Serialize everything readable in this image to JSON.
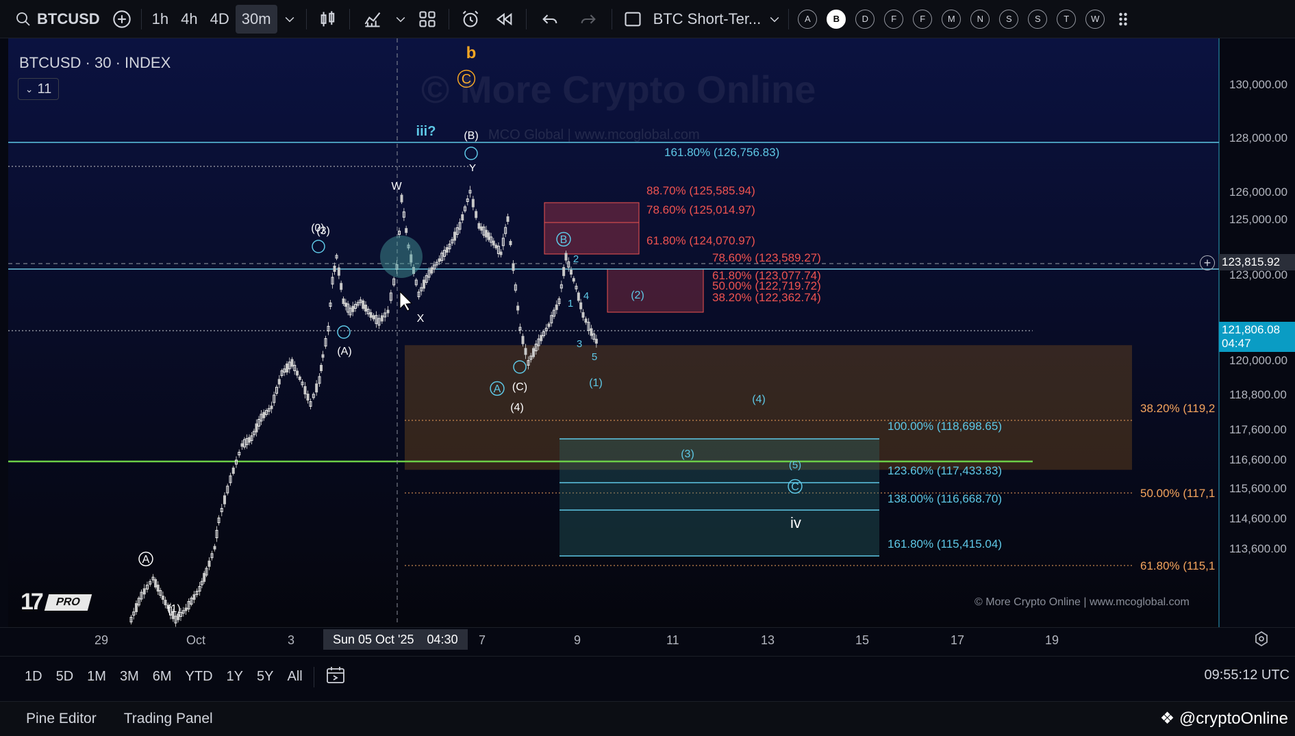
{
  "toolbar": {
    "symbol": "BTCUSD",
    "intervals": [
      "1h",
      "4h",
      "4D",
      "30m"
    ],
    "active_interval": "30m",
    "layout_name": "BTC Short-Ter...",
    "alert_letters": [
      "A",
      "B",
      "D",
      "F",
      "F",
      "M",
      "N",
      "S",
      "S",
      "T",
      "W"
    ],
    "active_letter_index": 1
  },
  "legend": {
    "title": "BTCUSD · 30 · INDEX",
    "indicator_count": "11"
  },
  "watermark": {
    "big": "© More Crypto Online",
    "sub": "MCO Global  |  www.mcoglobal.com",
    "footer": "© More Crypto Online  |  www.mcoglobal.com"
  },
  "price_scale": {
    "labels": [
      "130,000.00",
      "128,000.00",
      "126,000.00",
      "125,000.00",
      "123,000.00",
      "120,000.00",
      "118,800.00",
      "117,600.00",
      "116,600.00",
      "115,600.00",
      "114,600.00",
      "113,600.00"
    ],
    "crosshair_price": "123,815.92",
    "last_price": "121,806.08",
    "countdown": "04:47"
  },
  "colors": {
    "background": "#060812",
    "up": "#e8e8e8",
    "fib_cyan": "#5ec8e6",
    "fib_red": "#ef5350",
    "fib_orange": "#f5a45d",
    "support_green": "#6ccf48",
    "wave_orange": "#f5a623"
  },
  "chart_data": {
    "type": "candlestick",
    "timeframe": "30",
    "x_ticks": [
      "29",
      "Oct",
      "3",
      "Sun 05 Oct '25",
      "04:30",
      "7",
      "9",
      "11",
      "13",
      "15",
      "17",
      "19"
    ],
    "ylim": [
      113600,
      130000
    ],
    "fib_levels_cyan": [
      {
        "label": "161.80% (126,756.83)",
        "price": 126756.83
      },
      {
        "label": "100.00% (118,698.65)",
        "price": 118698.65
      },
      {
        "label": "123.60% (117,433.83)",
        "price": 117433.83
      },
      {
        "label": "138.00% (116,668.70)",
        "price": 116668.7
      },
      {
        "label": "161.80% (115,415.04)",
        "price": 115415.04
      }
    ],
    "fib_levels_red": [
      {
        "label": "88.70% (125,585.94)",
        "price": 125585.94
      },
      {
        "label": "78.60% (125,014.97)",
        "price": 125014.97
      },
      {
        "label": "61.80% (124,070.97)",
        "price": 124070.97
      },
      {
        "label": "78.60% (123,589.27)",
        "price": 123589.27
      },
      {
        "label": "61.80% (123,077.74)",
        "price": 123077.74
      },
      {
        "label": "50.00% (122,719.72)",
        "price": 122719.72
      },
      {
        "label": "38.20% (122,362.74)",
        "price": 122362.74
      }
    ],
    "fib_levels_orange": [
      {
        "label": "38.20% (119,2",
        "price": 119200
      },
      {
        "label": "50.00% (117,1",
        "price": 117100
      },
      {
        "label": "61.80% (115,1",
        "price": 115100
      }
    ],
    "wave_labels": [
      "b",
      "C",
      "iii?",
      "(B)",
      "Y",
      "W",
      "(0)",
      "(3)",
      "X",
      "(A)",
      "B",
      "2",
      "1",
      "4",
      "(2)",
      "3",
      "5",
      "A",
      "(C)",
      "(1)",
      "(4)",
      "(4)",
      "(3)",
      "(5)",
      "C",
      "iv",
      "A",
      "(1)"
    ]
  },
  "time_axis": {
    "crosshair_date": "Sun 05 Oct '25",
    "crosshair_time": "04:30"
  },
  "range_bar": {
    "ranges": [
      "1D",
      "5D",
      "1M",
      "3M",
      "6M",
      "YTD",
      "1Y",
      "5Y",
      "All"
    ],
    "clock": "09:55:12 UTC"
  },
  "bottom": {
    "tabs": [
      "Pine Editor",
      "Trading Panel"
    ],
    "brand": "@cryptoOnline"
  }
}
